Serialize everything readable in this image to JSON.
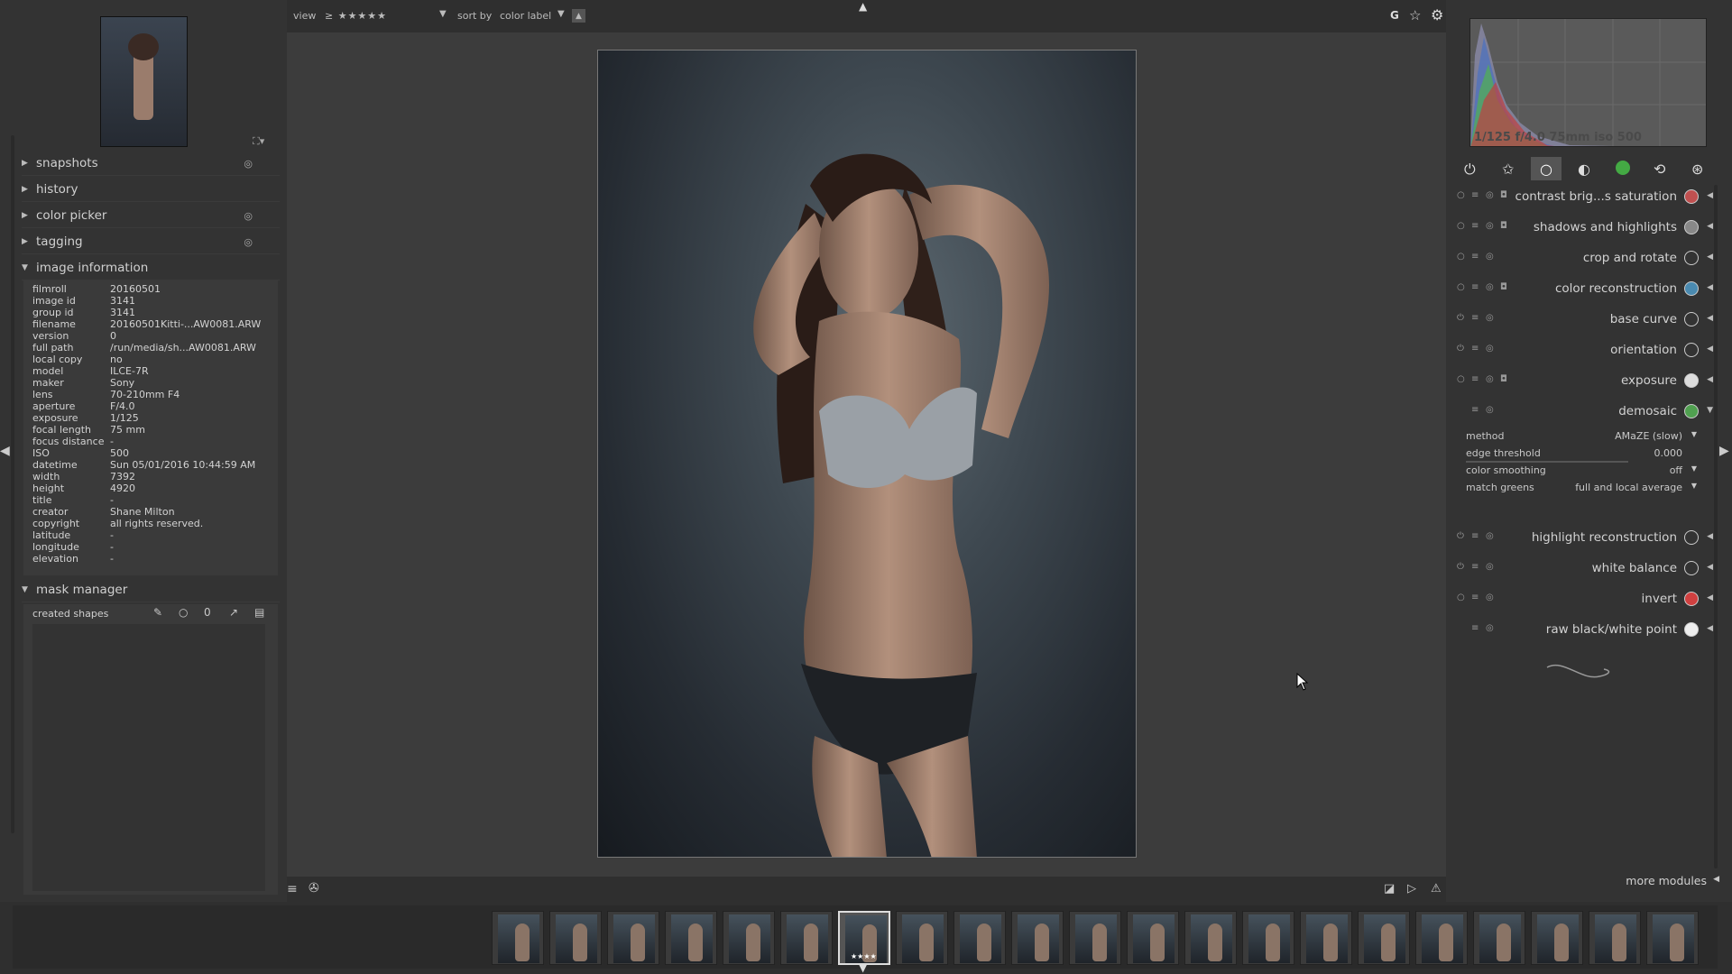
{
  "top": {
    "view_label": "view",
    "rating_filter": "≥ ★★★★★",
    "sort_label": "sort by",
    "sort_value": "color label",
    "right_g": "G"
  },
  "left": {
    "sections": [
      {
        "label": "snapshots"
      },
      {
        "label": "history"
      },
      {
        "label": "color picker"
      },
      {
        "label": "tagging"
      }
    ],
    "image_information_title": "image information",
    "info": [
      {
        "k": "filmroll",
        "v": "20160501"
      },
      {
        "k": "image id",
        "v": "3141"
      },
      {
        "k": "group id",
        "v": "3141"
      },
      {
        "k": "filename",
        "v": "20160501Kitti-...AW0081.ARW"
      },
      {
        "k": "version",
        "v": "0"
      },
      {
        "k": "full path",
        "v": "/run/media/sh...AW0081.ARW"
      },
      {
        "k": "local copy",
        "v": "no"
      },
      {
        "k": "model",
        "v": "ILCE-7R"
      },
      {
        "k": "maker",
        "v": "Sony"
      },
      {
        "k": "lens",
        "v": "70-210mm F4"
      },
      {
        "k": "aperture",
        "v": "F/4.0"
      },
      {
        "k": "exposure",
        "v": "1/125"
      },
      {
        "k": "focal length",
        "v": "75 mm"
      },
      {
        "k": "focus distance",
        "v": "-"
      },
      {
        "k": "ISO",
        "v": "500"
      },
      {
        "k": "datetime",
        "v": "Sun 05/01/2016 10:44:59 AM"
      },
      {
        "k": "width",
        "v": "7392"
      },
      {
        "k": "height",
        "v": "4920"
      },
      {
        "k": "title",
        "v": "-"
      },
      {
        "k": "creator",
        "v": "Shane Milton"
      },
      {
        "k": "copyright",
        "v": "all rights reserved."
      },
      {
        "k": "latitude",
        "v": "-"
      },
      {
        "k": "longitude",
        "v": "-"
      },
      {
        "k": "elevation",
        "v": "-"
      }
    ],
    "mask_manager_title": "mask manager",
    "created_shapes": "created shapes"
  },
  "right": {
    "histogram_info": "1/125 f/4.0 75mm iso 500",
    "modules": [
      {
        "name": "contrast brig...s saturation",
        "icon_color": "#c05050"
      },
      {
        "name": "shadows and highlights",
        "icon_color": "#888888"
      },
      {
        "name": "crop and rotate",
        "icon_color": "#333333"
      },
      {
        "name": "color reconstruction",
        "icon_color": "#4a8ab0"
      },
      {
        "name": "base curve",
        "icon_color": "#333333"
      },
      {
        "name": "orientation",
        "icon_color": "#333333"
      },
      {
        "name": "exposure",
        "icon_color": "#dddddd"
      },
      {
        "name": "demosaic",
        "icon_color": "#50a050"
      },
      {
        "name": "highlight reconstruction",
        "icon_color": "#333333"
      },
      {
        "name": "white balance",
        "icon_color": "#333333"
      },
      {
        "name": "invert",
        "icon_color": "#d04040"
      },
      {
        "name": "raw black/white point",
        "icon_color": "#eeeeee"
      }
    ],
    "demosaic_params": [
      {
        "k": "method",
        "v": "AMaZE (slow)"
      },
      {
        "k": "edge threshold",
        "v": "0.000"
      },
      {
        "k": "color smoothing",
        "v": "off"
      },
      {
        "k": "match greens",
        "v": "full and local average"
      }
    ],
    "more_modules": "more modules",
    "rating_stars": "★★★★"
  }
}
